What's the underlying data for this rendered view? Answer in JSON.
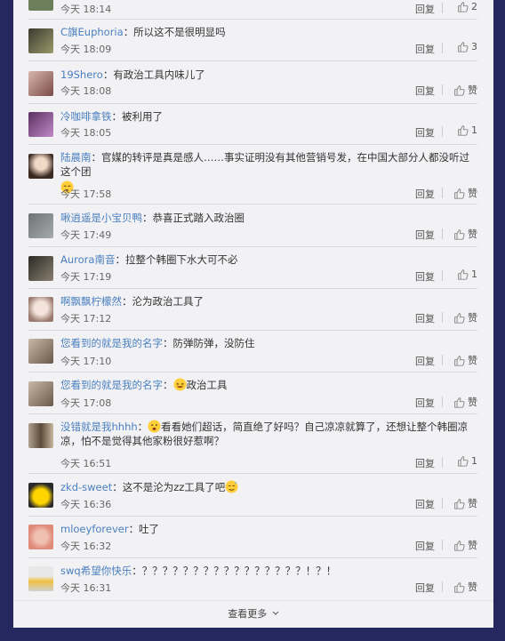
{
  "actions": {
    "reply_label": "回复",
    "like_label": "赞"
  },
  "footer": {
    "more_label": "查看更多"
  },
  "comments": [
    {
      "user": "",
      "text": "",
      "time": "今天 18:14",
      "likes": "2"
    },
    {
      "user": "C旗Euphoria",
      "text": "：所以这不是很明显吗",
      "time": "今天 18:09",
      "likes": "3"
    },
    {
      "user": "19Shero",
      "text": "：有政治工具内味儿了",
      "time": "今天 18:08",
      "likes": "赞"
    },
    {
      "user": "冷咖啡拿铁",
      "text": "：被利用了",
      "time": "今天 18:05",
      "likes": "1"
    },
    {
      "user": "陆晨南",
      "text": "：官媒的转评是真是感人……事实证明没有其他营销号发，在中国大部分人都没听过这个团",
      "time": "今天 17:58",
      "likes": "赞"
    },
    {
      "user": "啾逍遥是小宝贝鸭",
      "text": "：恭喜正式踏入政治圈",
      "time": "今天 17:49",
      "likes": "赞"
    },
    {
      "user": "Aurora南音",
      "text": "：拉整个韩圈下水大可不必",
      "time": "今天 17:19",
      "likes": "1"
    },
    {
      "user": "啊飘飘柠檬然",
      "text": "：沦为政治工具了",
      "time": "今天 17:12",
      "likes": "赞"
    },
    {
      "user": "您看到的就是我的名字",
      "text": "：防弹防弹，没防住",
      "time": "今天 17:10",
      "likes": "赞"
    },
    {
      "user": "您看到的就是我的名字",
      "text": "：",
      "text2": "政治工具",
      "time": "今天 17:08",
      "likes": "赞"
    },
    {
      "user": "没错就是我hhhh",
      "text": "：",
      "text2": "看看她们超话，简直绝了好吗？自己凉凉就算了，还想让整个韩圈凉凉，怕不是觉得其他家粉很好惹啊？",
      "time": "今天 16:51",
      "likes": "1"
    },
    {
      "user": "zkd-sweet",
      "text": "：这不是沦为zz工具了吧",
      "time": "今天 16:36",
      "likes": "赞"
    },
    {
      "user": "mloeyforever",
      "text": "：吐了",
      "time": "今天 16:32",
      "likes": "赞"
    },
    {
      "user": "swq希望你快乐",
      "text": "：？？？？？？？？？？？？？？？？！？！",
      "time": "今天 16:31",
      "likes": "赞"
    }
  ],
  "colors": {
    "background": "#24285e",
    "panel": "#f2f2f5",
    "username": "#4a7fbf"
  }
}
